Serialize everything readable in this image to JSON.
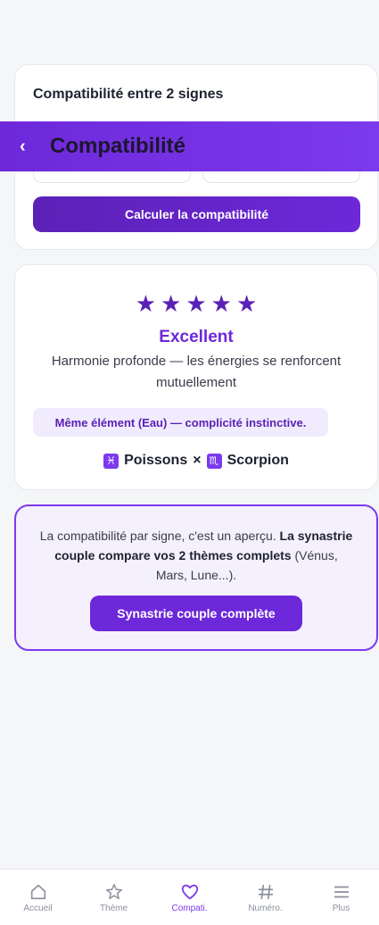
{
  "header": {
    "title": "Compatibilité"
  },
  "form": {
    "title": "Compatibilité entre 2 signes",
    "submit_label": "Calculer la compatibilité"
  },
  "result": {
    "stars": 5,
    "stars_max": 5,
    "verdict": "Excellent",
    "description": "Harmonie profonde — les énergies se renforcent mutuellement",
    "element_note": "Même élément (Eau) — complicité instinctive.",
    "sign1": {
      "glyph": "♓",
      "name": "Poissons"
    },
    "separator": "×",
    "sign2": {
      "glyph": "♏",
      "name": "Scorpion"
    }
  },
  "promo": {
    "text_start": "La compatibilité par signe, c'est un aperçu. ",
    "text_bold": "La synastrie couple compare vos 2 thèmes complets",
    "text_end": " (Vénus, Mars, Lune...).",
    "button_label": "Synastrie couple complète"
  },
  "nav": {
    "items": [
      {
        "label": "Accueil",
        "icon": "home-icon"
      },
      {
        "label": "Thème",
        "icon": "star-icon"
      },
      {
        "label": "Compati.",
        "icon": "heart-icon",
        "active": true
      },
      {
        "label": "Numéro.",
        "icon": "hash-icon"
      },
      {
        "label": "Plus",
        "icon": "menu-icon"
      }
    ]
  },
  "colors": {
    "accent": "#6d28d9",
    "accent_light": "#f1ecfd",
    "star": "#5b21b6",
    "nav_inactive": "#8a8f9c"
  }
}
